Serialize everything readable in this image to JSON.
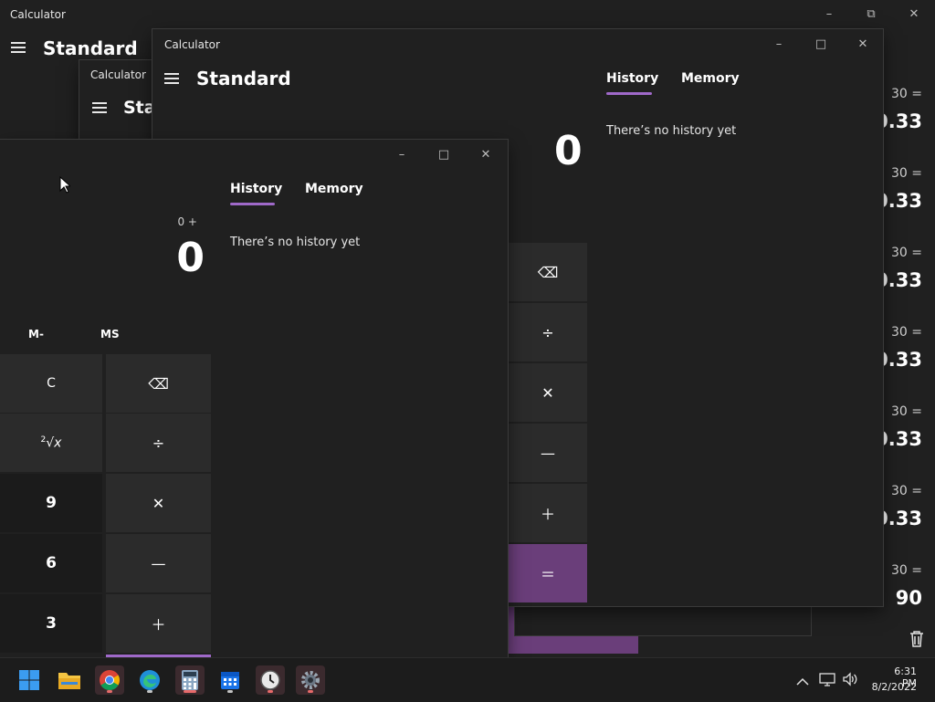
{
  "bg_window": {
    "title": "Calculator",
    "mode": "Standard",
    "history": [
      {
        "expr": "30 =",
        "result": "0.33"
      },
      {
        "expr": "30 =",
        "result": "0.33"
      },
      {
        "expr": "30 =",
        "result": "0.33"
      },
      {
        "expr": "30 =",
        "result": "0.33"
      },
      {
        "expr": "30 =",
        "result": "0.33"
      },
      {
        "expr": "30 =",
        "result": "0.33"
      },
      {
        "expr": "30 =",
        "result": "90"
      }
    ]
  },
  "small_window": {
    "title": "Calculator",
    "mode": "Star"
  },
  "mid_window": {
    "title": "Calculator",
    "mode": "Standard",
    "display": "0",
    "tabs": {
      "history": "History",
      "memory": "Memory"
    },
    "no_history": "There’s no history yet"
  },
  "front_window": {
    "expression": "0 +",
    "display": "0",
    "tabs": {
      "history": "History",
      "memory": "Memory"
    },
    "no_history": "There’s no history yet",
    "memory_buttons": {
      "m_minus": "M-",
      "ms": "MS"
    },
    "keys": {
      "clear": "C",
      "nine": "9",
      "six": "6",
      "three": "3"
    }
  },
  "taskbar": {
    "time": "6:31 PM",
    "date": "8/2/2022",
    "apps": [
      "start-icon",
      "file-explorer-icon",
      "chrome-icon",
      "edge-icon",
      "calculator-app-icon",
      "calendar-icon",
      "clock-icon",
      "settings-icon"
    ]
  },
  "colors": {
    "accent": "#9f69c9",
    "equals": "#6a3e7a",
    "background": "#202020"
  }
}
